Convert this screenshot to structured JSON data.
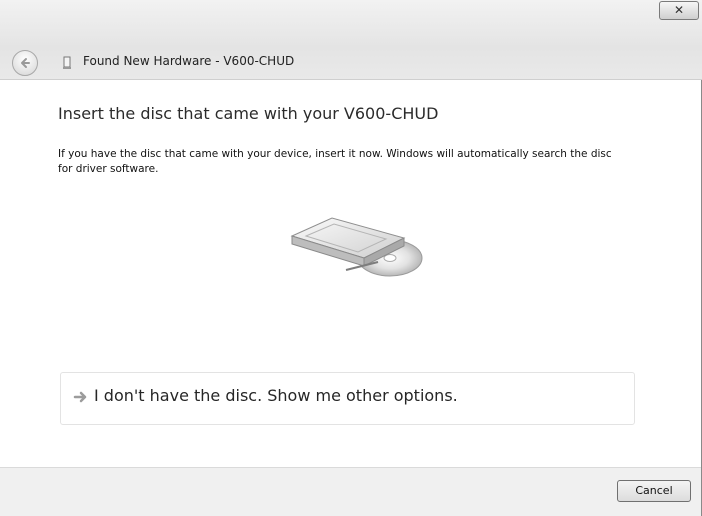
{
  "window": {
    "title": "Found New Hardware - V600-CHUD",
    "close_label": "✕"
  },
  "content": {
    "heading": "Insert the disc that came with your V600-CHUD",
    "description": "If you have the disc that came with your device, insert it now.  Windows will automatically search the disc for driver software.",
    "option_label": "I don't have the disc.  Show me other options."
  },
  "footer": {
    "cancel_label": "Cancel"
  },
  "icons": {
    "back": "back-arrow-icon",
    "hardware": "hardware-device-icon",
    "illustration": "disc-drive-icon",
    "option": "right-arrow-icon"
  }
}
